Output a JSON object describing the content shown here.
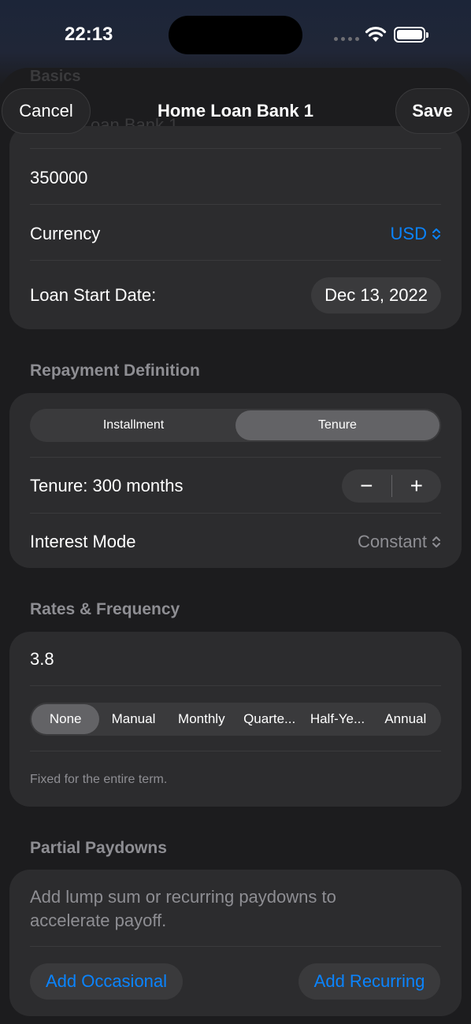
{
  "status_bar": {
    "time": "22:13"
  },
  "background": {
    "section": "Basics",
    "name": "Home Loan Bank 1"
  },
  "nav": {
    "cancel": "Cancel",
    "title": "Home Loan Bank 1",
    "save": "Save"
  },
  "basics": {
    "amount": "350000",
    "currency_label": "Currency",
    "currency_value": "USD",
    "start_date_label": "Loan Start Date:",
    "start_date_value": "Dec 13, 2022"
  },
  "repayment": {
    "title": "Repayment Definition",
    "segments": [
      "Installment",
      "Tenure"
    ],
    "selected": "Tenure",
    "tenure_label": "Tenure: 300 months",
    "stepper_minus": "−",
    "stepper_plus": "+",
    "interest_label": "Interest Mode",
    "interest_value": "Constant"
  },
  "rates": {
    "title": "Rates & Frequency",
    "rate": "3.8",
    "frequencies": [
      "None",
      "Manual",
      "Monthly",
      "Quarte...",
      "Half-Ye...",
      "Annual"
    ],
    "selected": "None",
    "note": "Fixed for the entire term."
  },
  "paydowns": {
    "title": "Partial Paydowns",
    "description": "Add lump sum or recurring paydowns to accelerate payoff.",
    "add_occasional": "Add Occasional",
    "add_recurring": "Add Recurring"
  },
  "colors": {
    "accent": "#0a84ff",
    "card": "#2c2c2e",
    "background": "#1c1c1e"
  }
}
